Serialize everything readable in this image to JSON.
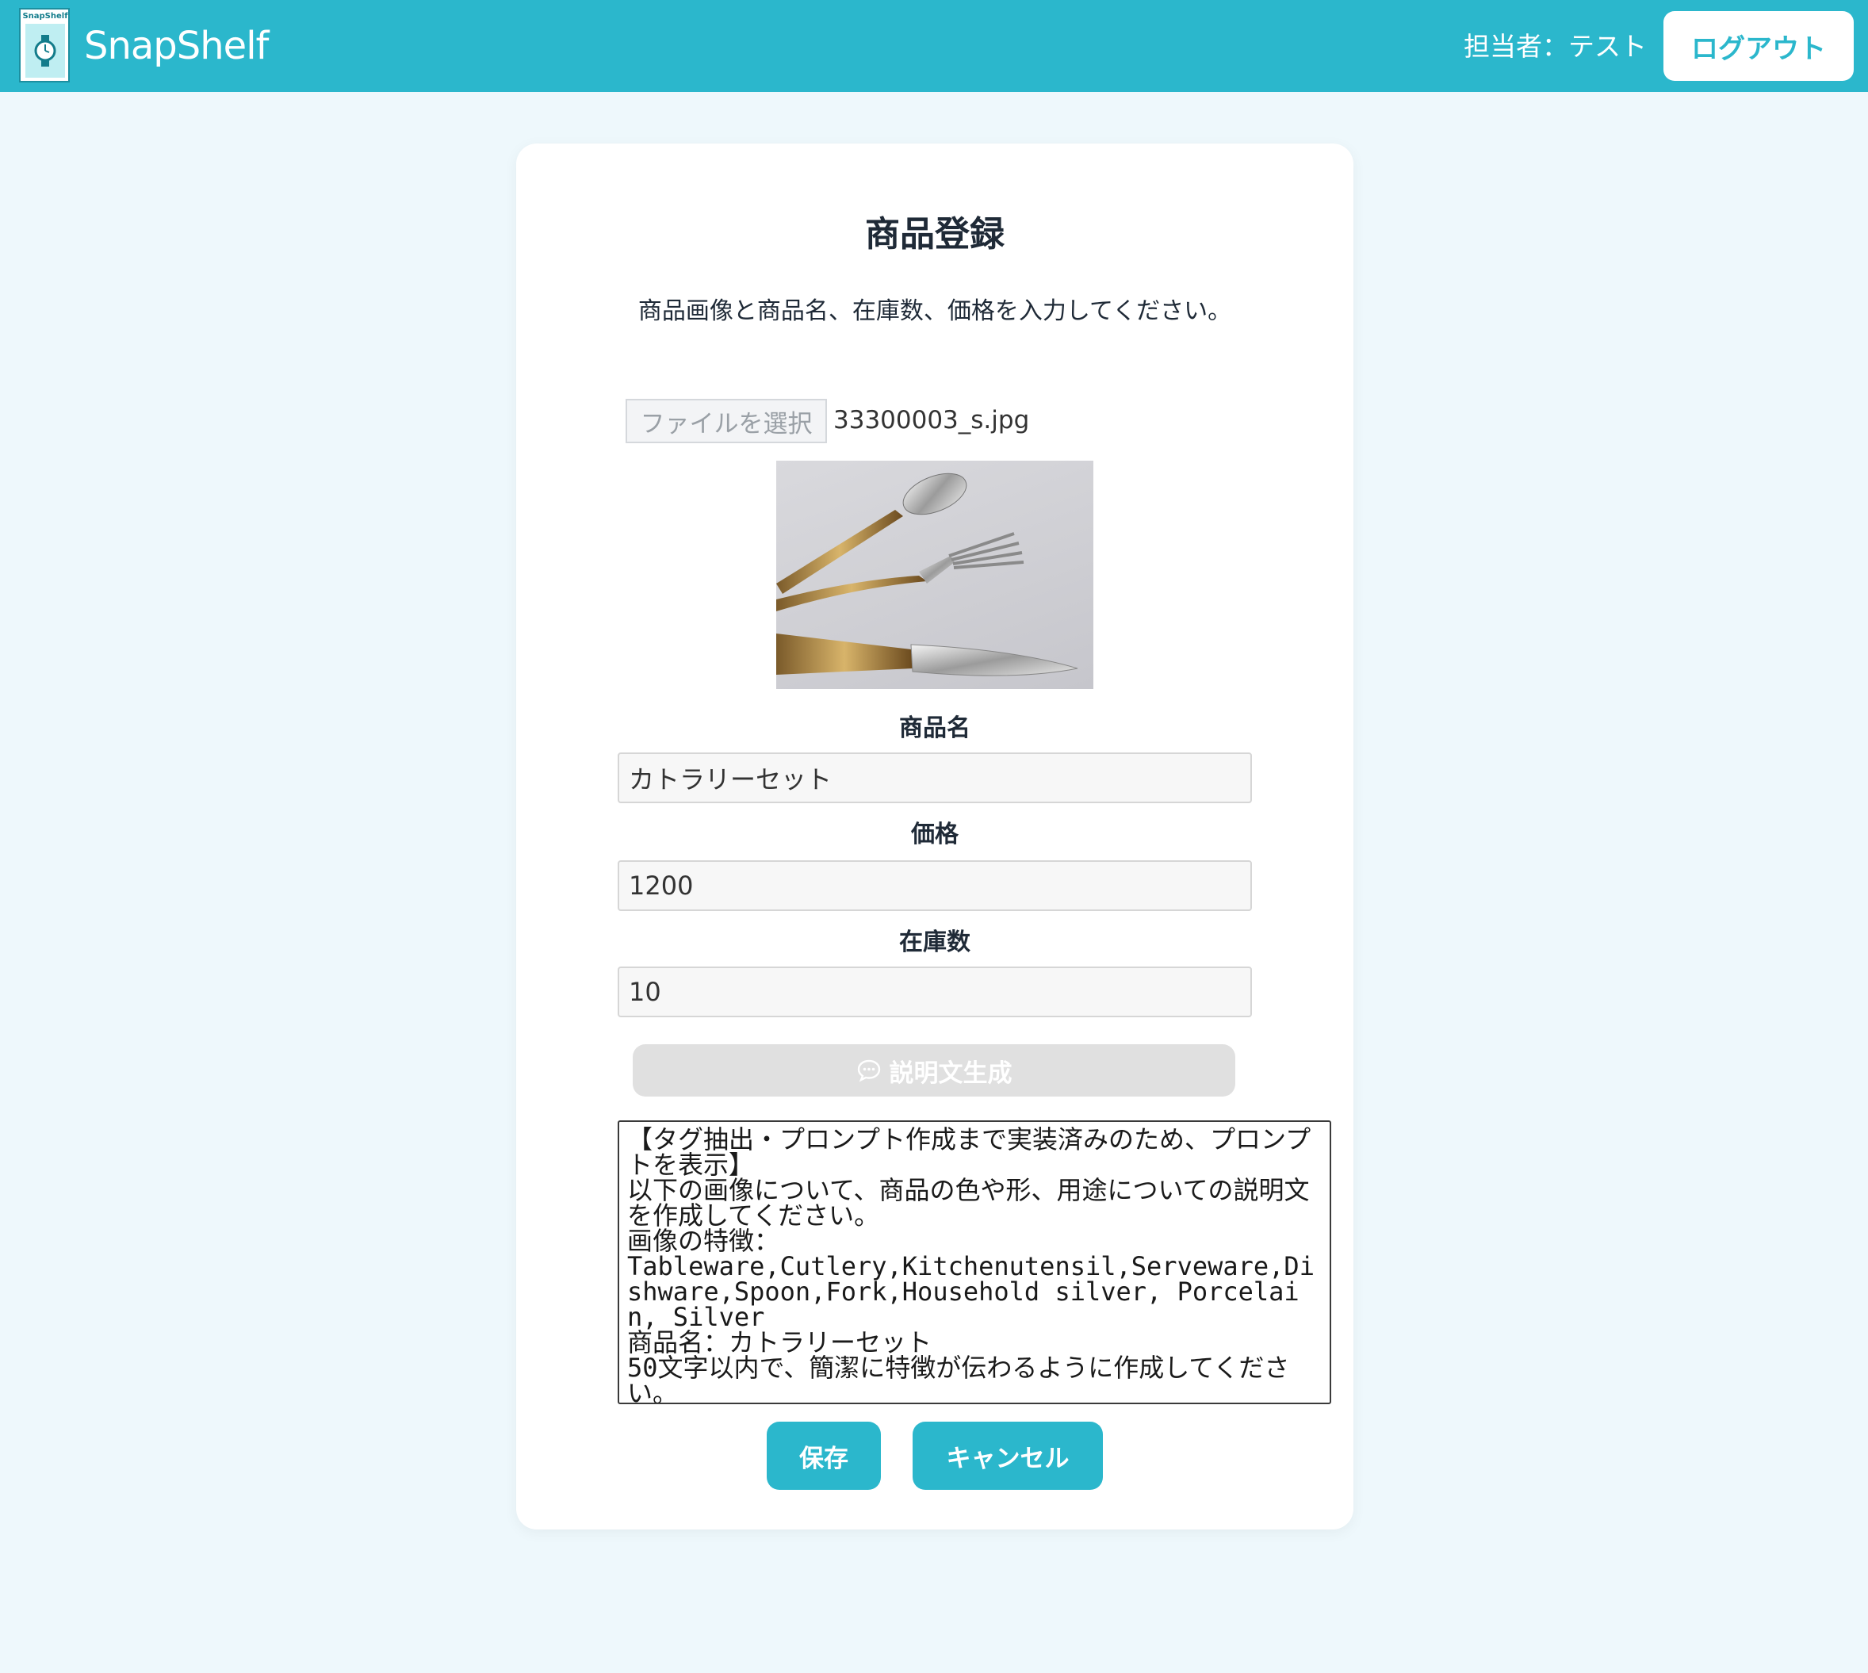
{
  "header": {
    "logo_text": "SnapShelf",
    "brand": "SnapShelf",
    "user_label": "担当者：テスト",
    "logout_label": "ログアウト"
  },
  "form": {
    "title": "商品登録",
    "subtitle": "商品画像と商品名、在庫数、価格を入力してください。",
    "file_button_label": "ファイルを選択",
    "file_name": "33300003_s.jpg",
    "fields": {
      "name": {
        "label": "商品名",
        "value": "カトラリーセット"
      },
      "price": {
        "label": "価格",
        "value": "1200"
      },
      "stock": {
        "label": "在庫数",
        "value": "10"
      }
    },
    "generate_button_label": "説明文生成",
    "generate_icon": "chat-bubble-icon",
    "description": "【タグ抽出・プロンプト作成まで実装済みのため、プロンプトを表示】\n以下の画像について、商品の色や形、用途についての説明文を作成してください。\n画像の特徴：\nTableware,Cutlery,Kitchenutensil,Serveware,Dishware,Spoon,Fork,Household silver, Porcelain, Silver\n商品名：カトラリーセット\n50文字以内で、簡潔に特徴が伝わるように作成してください。",
    "save_label": "保存",
    "cancel_label": "キャンセル"
  },
  "colors": {
    "accent": "#2bb7cc",
    "background": "#eef8fc",
    "card": "#ffffff",
    "disabled_button": "#e0e0e0"
  }
}
